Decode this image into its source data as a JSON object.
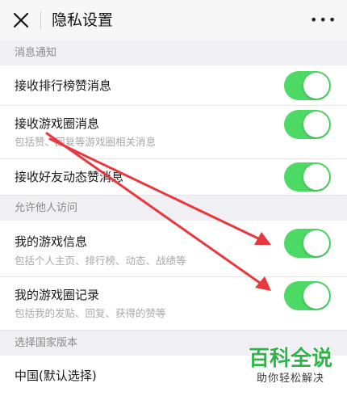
{
  "header": {
    "title": "隐私设置",
    "close_icon": "close-icon",
    "more_label": "•••"
  },
  "sections": {
    "notifications": {
      "title": "消息通知",
      "items": [
        {
          "label": "接收排行榜赞消息",
          "sub": "",
          "enabled": true
        },
        {
          "label": "接收游戏圈消息",
          "sub": "包括赞、回复等游戏圈相关消息",
          "enabled": true
        },
        {
          "label": "接收好友动态赞消息",
          "sub": "",
          "enabled": true
        }
      ]
    },
    "visitors": {
      "title": "允许他人访问",
      "items": [
        {
          "label": "我的游戏信息",
          "sub": "包括个人主页、排行榜、动态、战绩等",
          "enabled": true
        },
        {
          "label": "我的游戏圈记录",
          "sub": "包括我的发贴、回复、获得的赞等",
          "enabled": true
        }
      ]
    },
    "country": {
      "title": "选择国家版本",
      "items": [
        {
          "label": "中国(默认选择)"
        }
      ]
    }
  },
  "watermark": {
    "title": "百科全说",
    "subtitle": "助你轻松解决"
  },
  "colors": {
    "toggle_on": "#4cd964",
    "arrow": "#e8383d",
    "watermark": "#2fb44a"
  }
}
